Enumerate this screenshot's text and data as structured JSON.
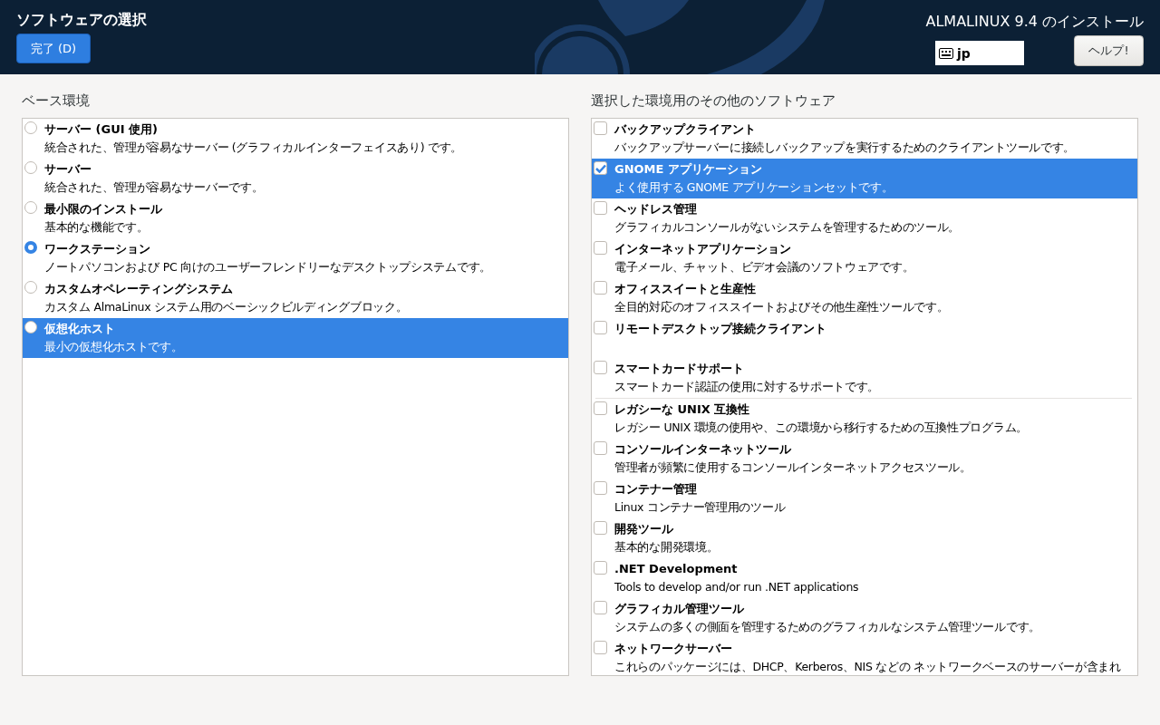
{
  "header": {
    "title": "ソフトウェアの選択",
    "done_button": "完了 (D)",
    "product": "ALMALINUX 9.4 のインストール",
    "keyboard_layout": "jp",
    "help_button": "ヘルプ!"
  },
  "base_environment": {
    "heading": "ベース環境",
    "items": [
      {
        "name": "サーバー (GUI 使用)",
        "description": "統合された、管理が容易なサーバー (グラフィカルインターフェイスあり) です。",
        "selected": false,
        "highlighted": false
      },
      {
        "name": "サーバー",
        "description": "統合された、管理が容易なサーバーです。",
        "selected": false,
        "highlighted": false
      },
      {
        "name": "最小限のインストール",
        "description": "基本的な機能です。",
        "selected": false,
        "highlighted": false
      },
      {
        "name": "ワークステーション",
        "description": "ノートパソコンおよび PC 向けのユーザーフレンドリーなデスクトップシステムです。",
        "selected": true,
        "highlighted": false
      },
      {
        "name": "カスタムオペレーティングシステム",
        "description": "カスタム AlmaLinux システム用のベーシックビルディングブロック。",
        "selected": false,
        "highlighted": false
      },
      {
        "name": "仮想化ホスト",
        "description": "最小の仮想化ホストです。",
        "selected": false,
        "highlighted": true
      }
    ]
  },
  "additional_software": {
    "heading": "選択した環境用のその他のソフトウェア",
    "groups": [
      [
        {
          "name": "バックアップクライアント",
          "description": "バックアップサーバーに接続しバックアップを実行するためのクライアントツールです。",
          "checked": false,
          "highlighted": false
        },
        {
          "name": "GNOME アプリケーション",
          "description": "よく使用する GNOME アプリケーションセットです。",
          "checked": true,
          "highlighted": true
        },
        {
          "name": "ヘッドレス管理",
          "description": "グラフィカルコンソールがないシステムを管理するためのツール。",
          "checked": false,
          "highlighted": false
        },
        {
          "name": "インターネットアプリケーション",
          "description": "電子メール、チャット、ビデオ会議のソフトウェアです。",
          "checked": false,
          "highlighted": false
        },
        {
          "name": "オフィススイートと生産性",
          "description": "全目的対応のオフィススイートおよびその他生産性ツールです。",
          "checked": false,
          "highlighted": false
        },
        {
          "name": "リモートデスクトップ接続クライアント",
          "checked": false,
          "highlighted": false
        },
        {
          "name": "スマートカードサポート",
          "description": "スマートカード認証の使用に対するサポートです。",
          "checked": false,
          "highlighted": false
        }
      ],
      [
        {
          "name": "レガシーな UNIX 互換性",
          "description": "レガシー UNIX 環境の使用や、この環境から移行するための互換性プログラム。",
          "checked": false,
          "highlighted": false
        },
        {
          "name": "コンソールインターネットツール",
          "description": "管理者が頻繁に使用するコンソールインターネットアクセスツール。",
          "checked": false,
          "highlighted": false
        },
        {
          "name": "コンテナー管理",
          "description": "Linux コンテナー管理用のツール",
          "checked": false,
          "highlighted": false
        },
        {
          "name": "開発ツール",
          "description": "基本的な開発環境。",
          "checked": false,
          "highlighted": false
        },
        {
          "name": ".NET Development",
          "description": "Tools to develop and/or run .NET applications",
          "checked": false,
          "highlighted": false
        },
        {
          "name": "グラフィカル管理ツール",
          "description": "システムの多くの側面を管理するためのグラフィカルなシステム管理ツールです。",
          "checked": false,
          "highlighted": false
        },
        {
          "name": "ネットワークサーバー",
          "description": "これらのパッケージには、DHCP、Kerberos、NIS などの ネットワークベースのサーバーが含まれ",
          "checked": false,
          "highlighted": false
        }
      ]
    ]
  }
}
